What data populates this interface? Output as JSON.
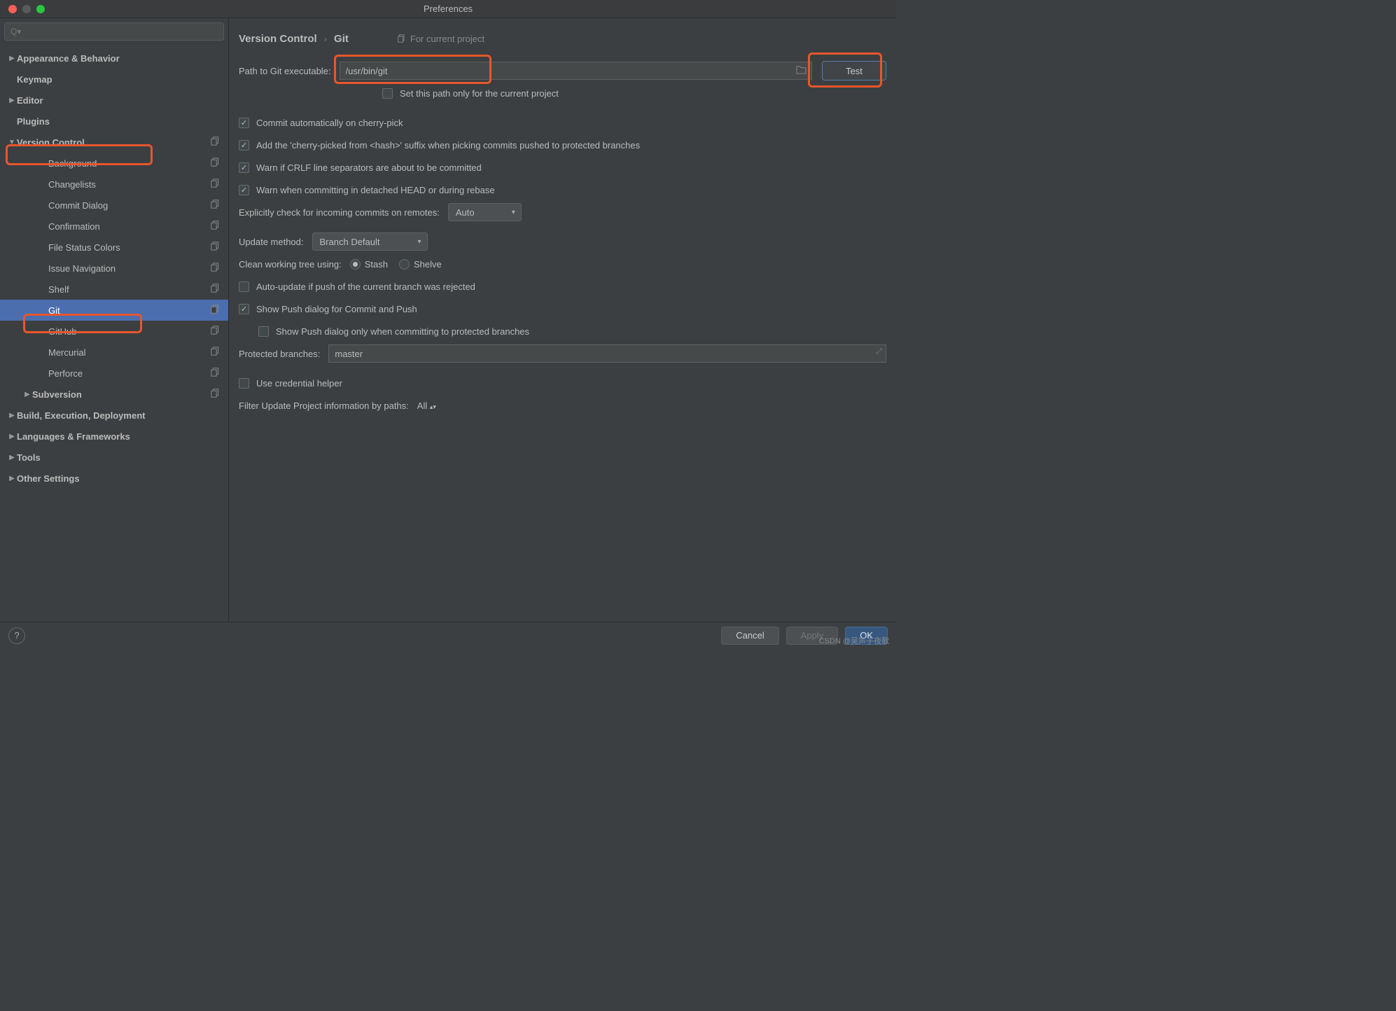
{
  "window": {
    "title": "Preferences"
  },
  "search": {
    "placeholder": "Q▾"
  },
  "sidebar": {
    "items": [
      {
        "label": "Appearance & Behavior",
        "arrow": "▶",
        "bold": true
      },
      {
        "label": "Keymap",
        "bold": true
      },
      {
        "label": "Editor",
        "arrow": "▶",
        "bold": true
      },
      {
        "label": "Plugins",
        "bold": true
      },
      {
        "label": "Version Control",
        "arrow": "▼",
        "bold": true,
        "copy": true
      },
      {
        "label": "Background",
        "child": true,
        "copy": true
      },
      {
        "label": "Changelists",
        "child": true,
        "copy": true
      },
      {
        "label": "Commit Dialog",
        "child": true,
        "copy": true
      },
      {
        "label": "Confirmation",
        "child": true,
        "copy": true
      },
      {
        "label": "File Status Colors",
        "child": true,
        "copy": true
      },
      {
        "label": "Issue Navigation",
        "child": true,
        "copy": true
      },
      {
        "label": "Shelf",
        "child": true,
        "copy": true
      },
      {
        "label": "Git",
        "child": true,
        "copy": true,
        "selected": true
      },
      {
        "label": "GitHub",
        "child": true,
        "copy": true
      },
      {
        "label": "Mercurial",
        "child": true,
        "copy": true
      },
      {
        "label": "Perforce",
        "child": true,
        "copy": true
      },
      {
        "label": "Subversion",
        "arrow": "▶",
        "bold": true,
        "mid": true,
        "copy": true
      },
      {
        "label": "Build, Execution, Deployment",
        "arrow": "▶",
        "bold": true
      },
      {
        "label": "Languages & Frameworks",
        "arrow": "▶",
        "bold": true
      },
      {
        "label": "Tools",
        "arrow": "▶",
        "bold": true
      },
      {
        "label": "Other Settings",
        "arrow": "▶",
        "bold": true
      }
    ]
  },
  "breadcrumb": {
    "a": "Version Control",
    "sep": "›",
    "b": "Git",
    "scope": "For current project"
  },
  "form": {
    "path_label": "Path to Git executable:",
    "path_value": "/usr/bin/git",
    "test": "Test",
    "set_path_only": "Set this path only for the current project",
    "cb_cherry": "Commit automatically on cherry-pick",
    "cb_suffix": "Add the 'cherry-picked from <hash>' suffix when picking commits pushed to protected branches",
    "cb_crlf": "Warn if CRLF line separators are about to be committed",
    "cb_detached": "Warn when committing in detached HEAD or during rebase",
    "explicit_label": "Explicitly check for incoming commits on remotes:",
    "explicit_value": "Auto",
    "update_label": "Update method:",
    "update_value": "Branch Default",
    "clean_label": "Clean working tree using:",
    "clean_stash": "Stash",
    "clean_shelve": "Shelve",
    "cb_autoupdate": "Auto-update if push of the current branch was rejected",
    "cb_showpush": "Show Push dialog for Commit and Push",
    "cb_showpush_protected": "Show Push dialog only when committing to protected branches",
    "protected_label": "Protected branches:",
    "protected_value": "master",
    "cb_cred": "Use credential helper",
    "filter_label": "Filter Update Project information by paths:",
    "filter_value": "All"
  },
  "footer": {
    "cancel": "Cancel",
    "apply": "Apply",
    "ok": "OK"
  },
  "watermark": "CSDN @吴声子夜歌"
}
